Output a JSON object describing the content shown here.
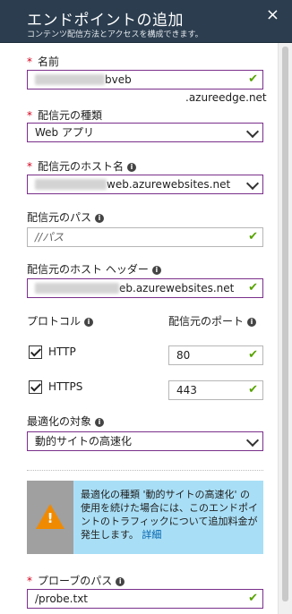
{
  "header": {
    "title": "エンドポイントの追加",
    "subtitle": "コンテンツ配信方法とアクセスを構成できます。",
    "close_label": "×"
  },
  "name": {
    "label": "名前",
    "value_suffix": "bveb",
    "domain_suffix": ".azureedge.net"
  },
  "origin_type": {
    "label": "配信元の種類",
    "value": "Web アプリ"
  },
  "origin_hostname": {
    "label": "配信元のホスト名",
    "value_suffix": "web.azurewebsites.net"
  },
  "origin_path": {
    "label": "配信元のパス",
    "placeholder": "//パス"
  },
  "origin_host_header": {
    "label": "配信元のホスト ヘッダー",
    "value_suffix": "eb.azurewebsites.net"
  },
  "protocol": {
    "label": "プロトコル",
    "http_label": "HTTP",
    "https_label": "HTTPS"
  },
  "origin_port": {
    "label": "配信元のポート",
    "http_port": "80",
    "https_port": "443"
  },
  "optimization": {
    "label": "最適化の対象",
    "value": "動的サイトの高速化"
  },
  "alert": {
    "text": "最適化の種類 '動的サイトの高速化' の使用を続けた場合には、このエンドポイントのトラフィックについて追加料金が発生します。",
    "link": "詳細"
  },
  "probe_path": {
    "label": "プローブのパス",
    "value": "/probe.txt"
  },
  "colors": {
    "header_bg": "#2b3d4f",
    "field_border": "#7a2f8a",
    "valid_check": "#57a300",
    "required_star": "#d6001c",
    "alert_bg": "#a9dff6",
    "warning_icon": "#f08a00"
  }
}
